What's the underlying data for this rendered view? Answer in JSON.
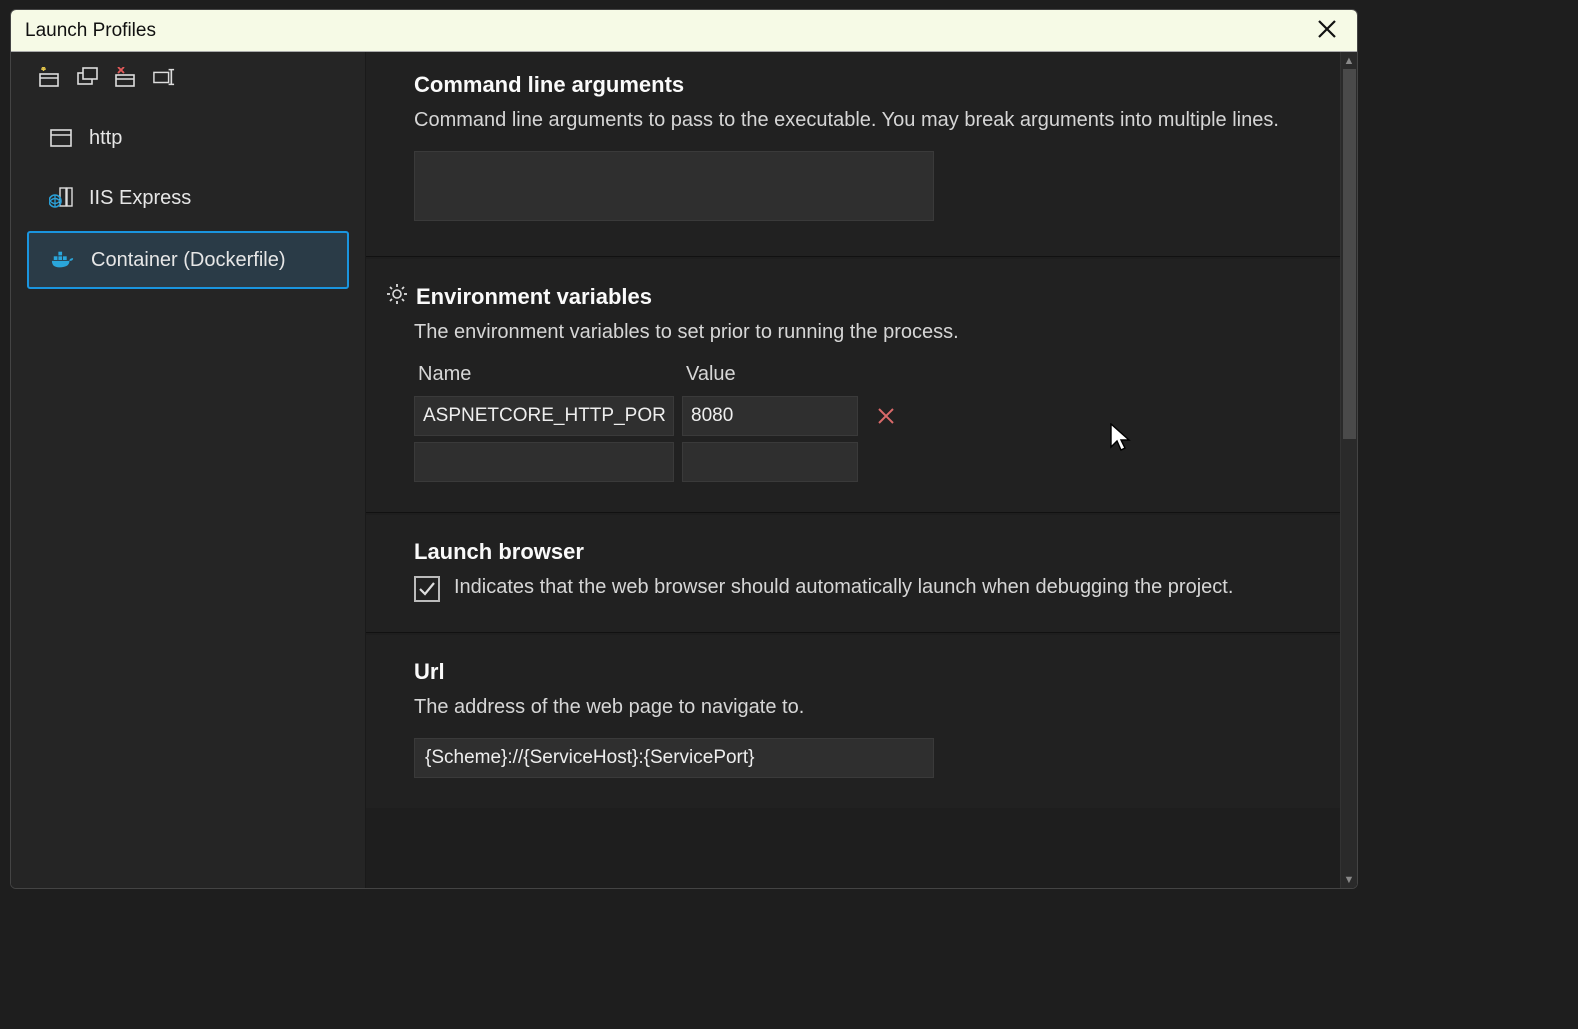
{
  "dialog": {
    "title": "Launch Profiles"
  },
  "sidebar": {
    "profiles": [
      {
        "label": "http"
      },
      {
        "label": "IIS Express"
      },
      {
        "label": "Container (Dockerfile)"
      }
    ],
    "selectedIndex": 2
  },
  "sections": {
    "cli": {
      "title": "Command line arguments",
      "desc": "Command line arguments to pass to the executable. You may break arguments into multiple lines.",
      "value": ""
    },
    "env": {
      "title": "Environment variables",
      "desc": "The environment variables to set prior to running the process.",
      "headers": {
        "name": "Name",
        "value": "Value"
      },
      "rows": [
        {
          "name": "ASPNETCORE_HTTP_PORTS",
          "value": "8080"
        }
      ]
    },
    "launchBrowser": {
      "title": "Launch browser",
      "desc": "Indicates that the web browser should automatically launch when debugging the project.",
      "checked": true
    },
    "url": {
      "title": "Url",
      "desc": "The address of the web page to navigate to.",
      "value": "{Scheme}://{ServiceHost}:{ServicePort}"
    }
  }
}
